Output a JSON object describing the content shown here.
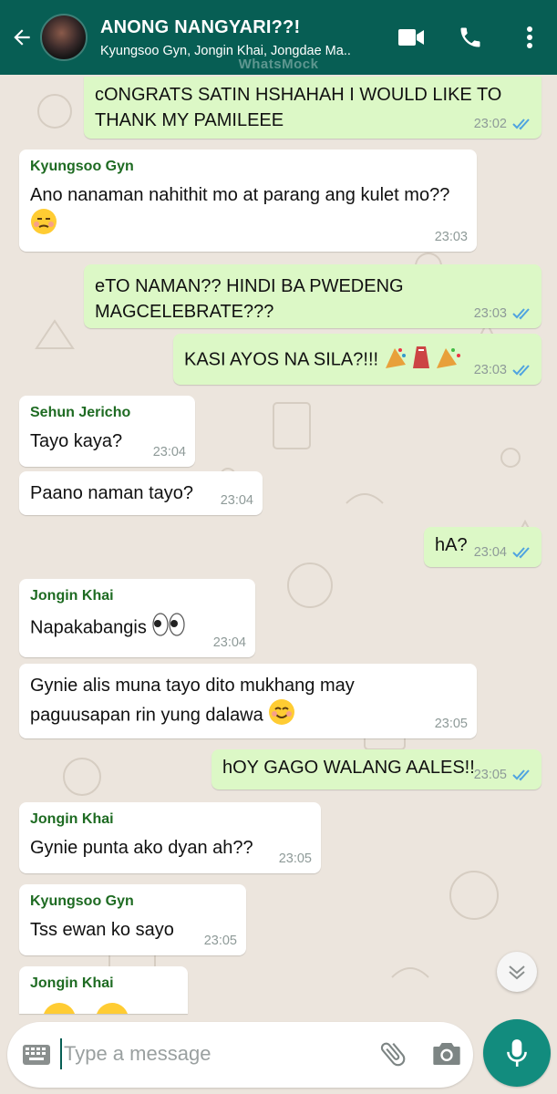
{
  "header": {
    "title": "ANONG NANGYARI??!",
    "subtitle": "Kyungsoo Gyn, Jongin Khai, Jongdae Ma..",
    "watermark": "WhatsMock",
    "colors": {
      "bar": "#075E54",
      "accent": "#128C7E"
    }
  },
  "messages": [
    {
      "type": "out",
      "text": "cONGRATS SATIN HSHAHAH I WOULD LIKE TO THANK MY PAMILEEE",
      "time": "23:02",
      "read": true
    },
    {
      "type": "in",
      "sender": "Kyungsoo Gyn",
      "text": "Ano nanaman nahithit mo at parang ang kulet mo??",
      "emoji": "unamused-face",
      "time": "23:03"
    },
    {
      "type": "out",
      "text": "eTO NAMAN?? HINDI BA PWEDENG MAGCELEBRATE???",
      "time": "23:03",
      "read": true
    },
    {
      "type": "out",
      "text": "KASI AYOS NA SILA?!!!",
      "emoji": "party-popper-icons",
      "time": "23:03",
      "read": true
    },
    {
      "type": "in",
      "sender": "Sehun Jericho",
      "text": "Tayo kaya?",
      "time": "23:04"
    },
    {
      "type": "in",
      "text": "Paano naman tayo?",
      "time": "23:04"
    },
    {
      "type": "out",
      "text": "hA?",
      "time": "23:04",
      "read": true
    },
    {
      "type": "in",
      "sender": "Jongin Khai",
      "text": "Napakabangis",
      "emoji": "eyes",
      "time": "23:04"
    },
    {
      "type": "in",
      "text": "Gynie alis muna tayo dito mukhang may paguusapan rin yung dalawa",
      "emoji": "smiling-face",
      "time": "23:05"
    },
    {
      "type": "out",
      "text": "hOY GAGO WALANG AALES!!",
      "time": "23:05",
      "read": true
    },
    {
      "type": "in",
      "sender": "Jongin Khai",
      "text": "Gynie punta ako dyan ah??",
      "time": "23:05"
    },
    {
      "type": "in",
      "sender": "Kyungsoo Gyn",
      "text": "Tss ewan ko sayo",
      "time": "23:05"
    },
    {
      "type": "in",
      "sender": "Jongin Khai",
      "text": "",
      "emoji": "partially-visible-emoji"
    }
  ],
  "input": {
    "placeholder": "Type a message"
  },
  "icons": [
    "back-arrow-icon",
    "video-call-icon",
    "phone-icon",
    "more-icon",
    "keyboard-icon",
    "attach-icon",
    "camera-icon",
    "mic-icon",
    "scroll-down-icon",
    "double-check-icon"
  ]
}
